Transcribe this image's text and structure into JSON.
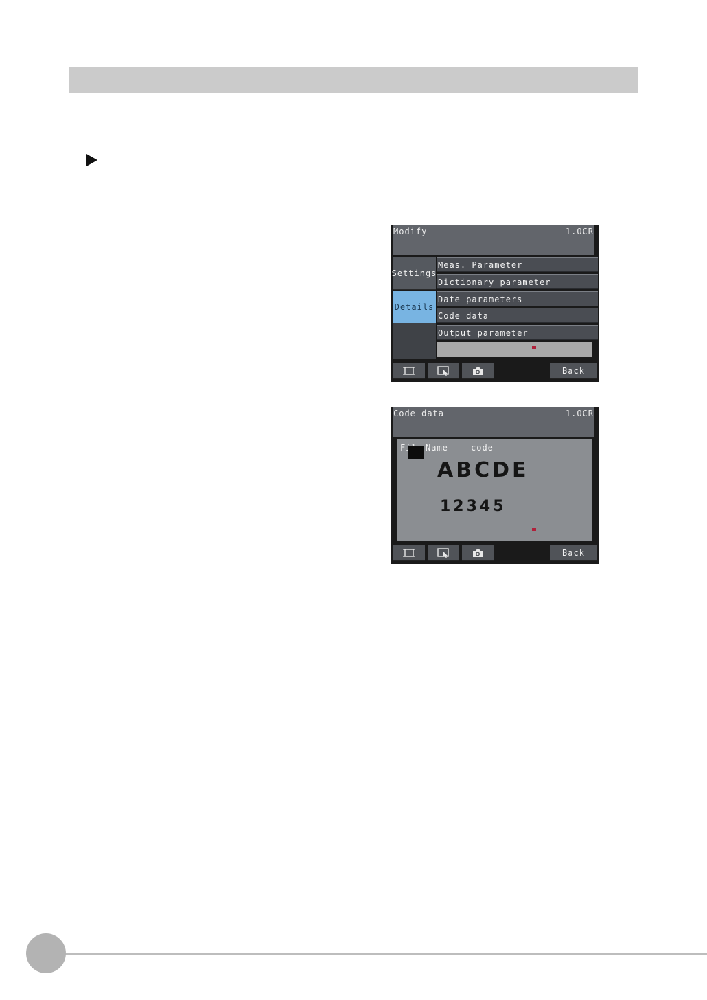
{
  "screen1": {
    "title": "Modify",
    "mode": "1.OCR",
    "tabs": [
      {
        "label": "Settings",
        "active": false
      },
      {
        "label": "Details",
        "active": true
      }
    ],
    "menu_items": [
      {
        "label": "Meas. Parameter"
      },
      {
        "label": "Dictionary parameter"
      },
      {
        "label": "Date parameters"
      },
      {
        "label": "Code data"
      },
      {
        "label": "Output parameter"
      }
    ],
    "toolbar": {
      "icons": [
        "frame-icon",
        "zoom-cursor-icon",
        "camera-icon"
      ],
      "back_label": "Back"
    }
  },
  "screen2": {
    "title": "Code data",
    "mode": "1.OCR",
    "columns": [
      "File",
      "Name",
      "code"
    ],
    "code_text": "ABCDE",
    "code_number": "12345",
    "toolbar": {
      "icons": [
        "frame-icon",
        "zoom-cursor-icon",
        "camera-icon"
      ],
      "back_label": "Back"
    }
  },
  "colors": {
    "active_tab": "#78b4e2",
    "title_bar": "#62656b",
    "section_bar": "#cbcbcb",
    "indicator": "#b0203a"
  }
}
